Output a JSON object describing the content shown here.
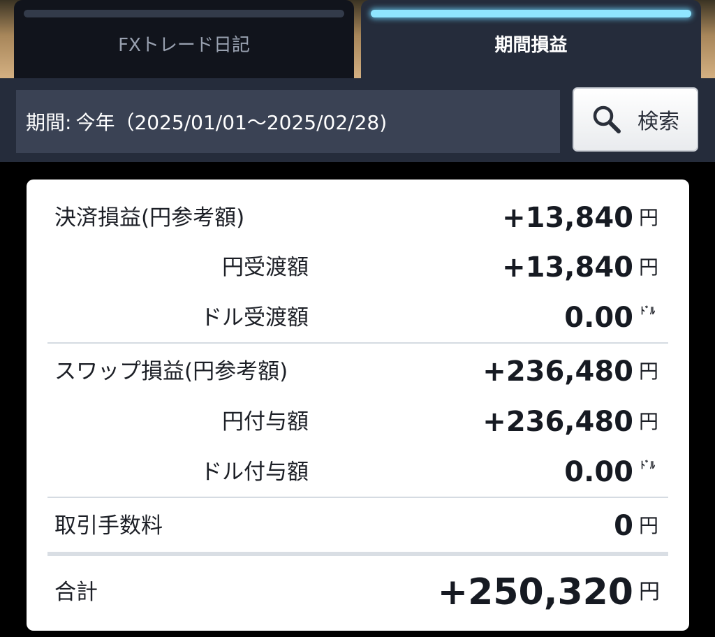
{
  "tabs": [
    {
      "label": "FXトレード日記",
      "active": false
    },
    {
      "label": "期間損益",
      "active": true
    }
  ],
  "filter": {
    "period_label": "期間:",
    "period_value": "今年（2025/01/01〜2025/02/28)",
    "search_label": "検索"
  },
  "summary": {
    "settlement": {
      "label": "決済損益(円参考額)",
      "value": "+13,840",
      "unit": "円"
    },
    "yen_received": {
      "label": "円受渡額",
      "value": "+13,840",
      "unit": "円"
    },
    "dollar_received": {
      "label": "ドル受渡額",
      "value": "0.00",
      "unit": "ﾄﾞﾙ"
    },
    "swap": {
      "label": "スワップ損益(円参考額)",
      "value": "+236,480",
      "unit": "円"
    },
    "yen_granted": {
      "label": "円付与額",
      "value": "+236,480",
      "unit": "円"
    },
    "dollar_granted": {
      "label": "ドル付与額",
      "value": "0.00",
      "unit": "ﾄﾞﾙ"
    },
    "fee": {
      "label": "取引手数料",
      "value": "0",
      "unit": "円"
    },
    "total": {
      "label": "合計",
      "value": "+250,320",
      "unit": "円"
    }
  },
  "colors": {
    "accent": "#8fe6ff",
    "header_bg": "#252c3b",
    "card_bg": "#ffffff"
  }
}
